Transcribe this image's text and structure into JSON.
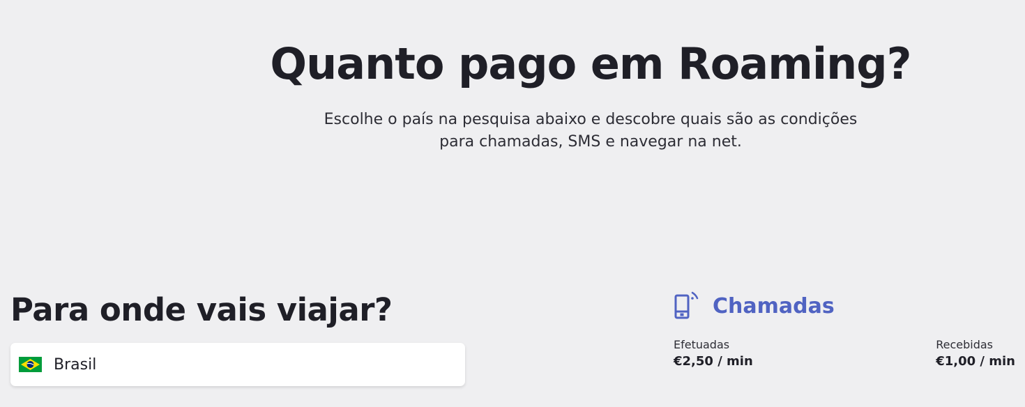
{
  "hero": {
    "title": "Quanto pago em Roaming?",
    "subtitle": "Escolhe o país na pesquisa abaixo e descobre quais são as condições para chamadas, SMS e navegar na net."
  },
  "travel": {
    "heading": "Para onde vais viajar?",
    "selected_country": "Brasil",
    "flag_icon": "brazil-flag-icon",
    "flag_colors": {
      "green": "#009c3b",
      "yellow": "#ffdf00",
      "blue": "#002776"
    }
  },
  "calls": {
    "icon": "phone-signal-icon",
    "title": "Chamadas",
    "accent_color": "#5063c2",
    "outgoing": {
      "label": "Efetuadas",
      "value": "€2,50 / min"
    },
    "incoming": {
      "label": "Recebidas",
      "value": "€1,00 / min"
    }
  }
}
